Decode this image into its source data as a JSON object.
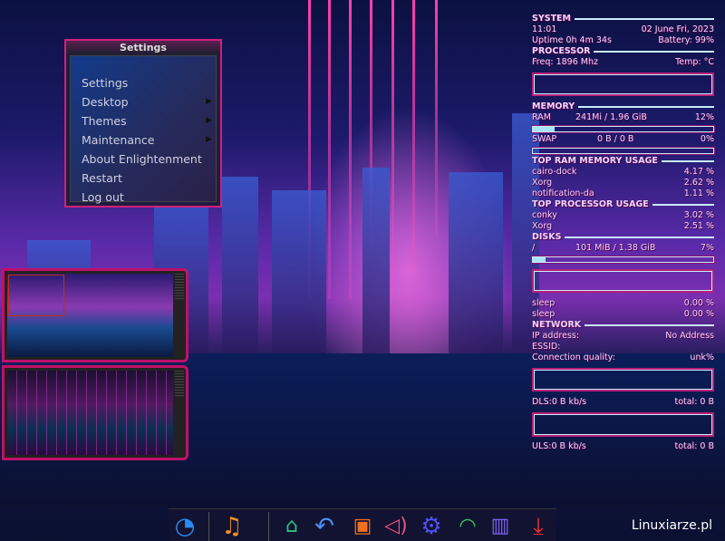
{
  "menu": {
    "title": "Settings",
    "items": [
      {
        "label": "Settings",
        "submenu": false
      },
      {
        "label": "Desktop",
        "submenu": true
      },
      {
        "label": "Themes",
        "submenu": true
      },
      {
        "label": "Maintenance",
        "submenu": true
      },
      {
        "label": "About Enlightenment",
        "submenu": false
      },
      {
        "label": "Restart",
        "submenu": false
      },
      {
        "label": "Log out",
        "submenu": false
      }
    ]
  },
  "conky": {
    "system": {
      "header": "SYSTEM",
      "time": "11:01",
      "date": "02 June Fri, 2023",
      "uptime": "Uptime 0h 4m 34s",
      "battery": "Battery: 99%"
    },
    "processor": {
      "header": "PROCESSOR",
      "freq": "Freq: 1896 Mhz",
      "temp": "Temp: °C"
    },
    "memory": {
      "header": "MEMORY",
      "ram_label": "RAM",
      "ram_value": "241Mi / 1.96 GiB",
      "ram_percent": "12%",
      "ram_fill": 12,
      "swap_label": "SWAP",
      "swap_value": "0 B / 0 B",
      "swap_percent": "0%",
      "swap_fill": 0
    },
    "top_ram": {
      "header": "TOP RAM MEMORY USAGE",
      "items": [
        {
          "name": "cairo-dock",
          "value": "4.17 %"
        },
        {
          "name": "Xorg",
          "value": "2.62 %"
        },
        {
          "name": "notification-da",
          "value": "1.11 %"
        }
      ]
    },
    "top_cpu": {
      "header": "TOP PROCESSOR USAGE",
      "items": [
        {
          "name": "conky",
          "value": "3.02 %"
        },
        {
          "name": "Xorg",
          "value": "2.51 %"
        }
      ]
    },
    "disks": {
      "header": "DISKS",
      "mount": "/",
      "value": "101 MiB / 1.38 GiB",
      "percent": "7%",
      "fill": 7
    },
    "io": [
      {
        "name": "sleep",
        "value": "0.00 %"
      },
      {
        "name": "sleep",
        "value": "0.00 %"
      }
    ],
    "network": {
      "header": "NETWORK",
      "ip_label": "IP address:",
      "ip_value": "No Address",
      "essid_label": "ESSID:",
      "quality_label": "Connection quality:",
      "quality_value": "unk%",
      "dls": "DLS:0 B kb/s",
      "dls_total": "total: 0 B",
      "uls": "ULS:0 B kb/s",
      "uls_total": "total: 0 B"
    }
  },
  "dock": {
    "icons": [
      "enlightenment-icon",
      "music-icon",
      "home-folder-icon",
      "undo-icon",
      "camera-folder-icon",
      "volume-icon",
      "settings-gear-icon",
      "wifi-icon",
      "trash-icon",
      "download-icon"
    ]
  },
  "watermark": "Linuxiarze.pl"
}
